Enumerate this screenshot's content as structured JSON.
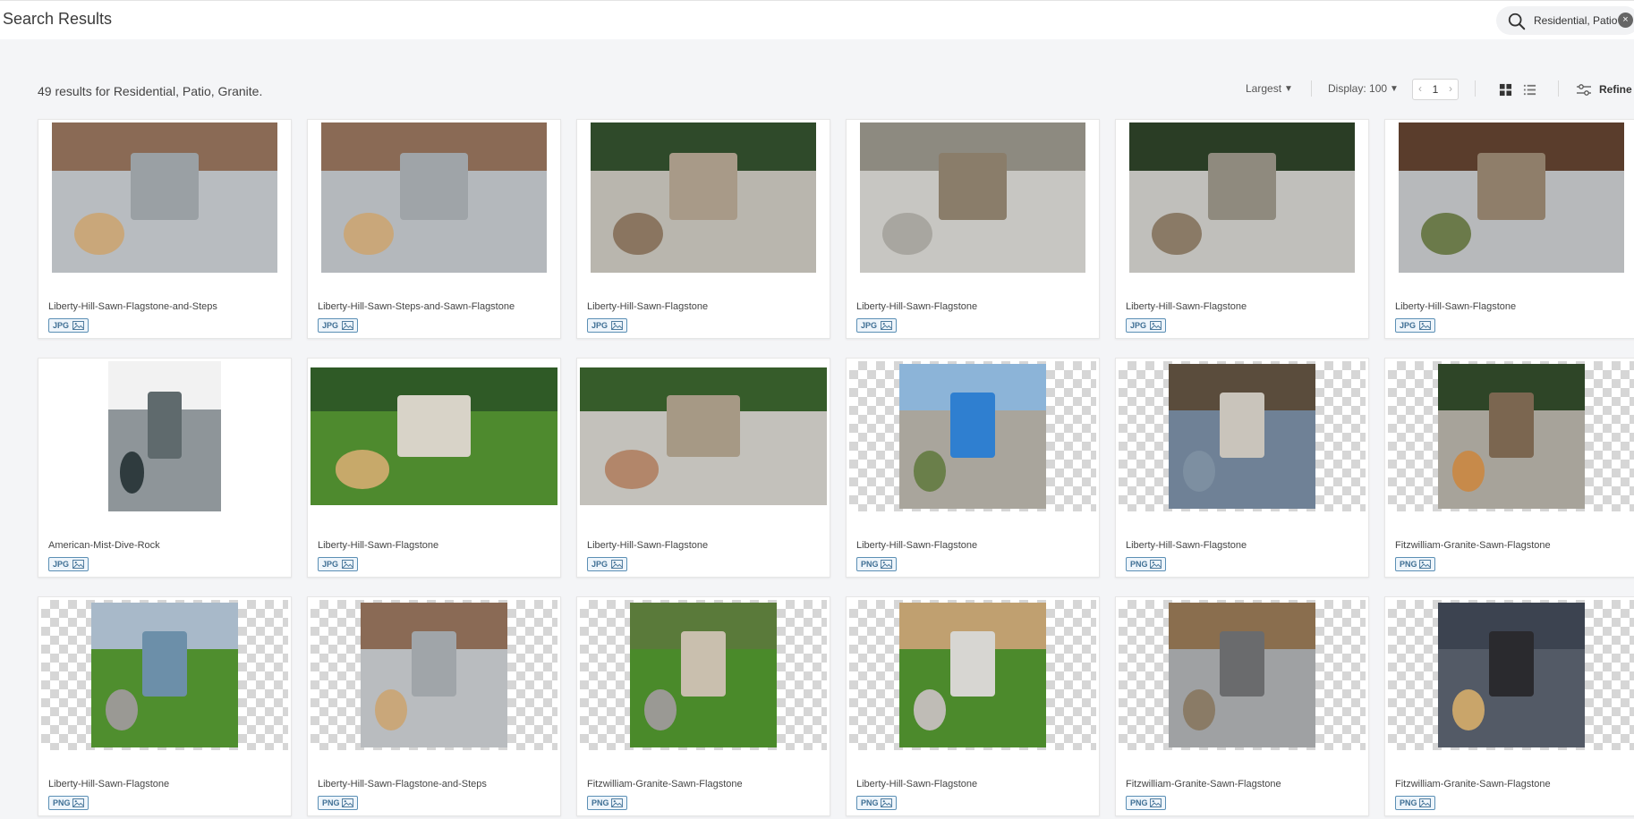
{
  "header": {
    "title": "Search Results",
    "search_query": "Residential, Patio"
  },
  "results": {
    "summary": "49 results for Residential, Patio, Granite.",
    "sort_label": "Largest",
    "display_label": "Display: 100",
    "page": "1",
    "refine_label": "Refine"
  },
  "colors": {
    "accent": "#3f6f94",
    "badge_border": "#5b8fb5"
  },
  "cards": [
    {
      "name": "Liberty-Hill-Sawn-Flagstone-and-Steps",
      "format": "JPG"
    },
    {
      "name": "Liberty-Hill-Sawn-Steps-and-Sawn-Flagstone",
      "format": "JPG"
    },
    {
      "name": "Liberty-Hill-Sawn-Flagstone",
      "format": "JPG"
    },
    {
      "name": "Liberty-Hill-Sawn-Flagstone",
      "format": "JPG"
    },
    {
      "name": "Liberty-Hill-Sawn-Flagstone",
      "format": "JPG"
    },
    {
      "name": "Liberty-Hill-Sawn-Flagstone",
      "format": "JPG"
    },
    {
      "name": "American-Mist-Dive-Rock",
      "format": "JPG"
    },
    {
      "name": "Liberty-Hill-Sawn-Flagstone",
      "format": "JPG"
    },
    {
      "name": "Liberty-Hill-Sawn-Flagstone",
      "format": "JPG"
    },
    {
      "name": "Liberty-Hill-Sawn-Flagstone",
      "format": "PNG"
    },
    {
      "name": "Liberty-Hill-Sawn-Flagstone",
      "format": "PNG"
    },
    {
      "name": "Fitzwilliam-Granite-Sawn-Flagstone",
      "format": "PNG"
    },
    {
      "name": "Liberty-Hill-Sawn-Flagstone",
      "format": "PNG"
    },
    {
      "name": "Liberty-Hill-Sawn-Flagstone-and-Steps",
      "format": "PNG"
    },
    {
      "name": "Fitzwilliam-Granite-Sawn-Flagstone",
      "format": "PNG"
    },
    {
      "name": "Liberty-Hill-Sawn-Flagstone",
      "format": "PNG"
    },
    {
      "name": "Fitzwilliam-Granite-Sawn-Flagstone",
      "format": "PNG"
    },
    {
      "name": "Fitzwilliam-Granite-Sawn-Flagstone",
      "format": "PNG"
    }
  ]
}
